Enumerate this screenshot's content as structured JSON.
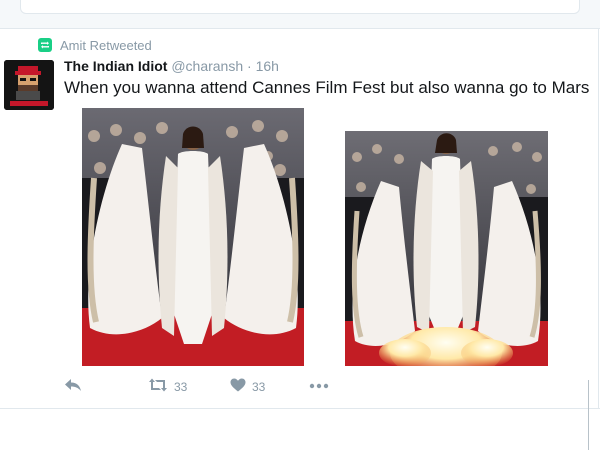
{
  "retweet": {
    "label": "Amit Retweeted",
    "icon": "retweet-icon"
  },
  "tweet": {
    "display_name": "The Indian Idiot",
    "handle": "@charansh",
    "separator": "·",
    "time": "16h",
    "text": "When you wanna attend Cannes Film Fest but also wanna go to Mars",
    "avatar_icon": "pixel-avatar-icon",
    "media": [
      {
        "description": "woman in white caped gown on red carpet"
      },
      {
        "description": "same gown edited with rocket exhaust flame"
      }
    ]
  },
  "actions": {
    "reply_icon": "reply-icon",
    "retweet_icon": "retweet-icon",
    "retweet_count": "33",
    "like_icon": "heart-icon",
    "like_count": "33",
    "more_icon": "more-dots-icon"
  },
  "colors": {
    "accent_green": "#19cf86",
    "muted": "#8899a6",
    "text": "#14171a",
    "border": "#e1e8ed"
  }
}
